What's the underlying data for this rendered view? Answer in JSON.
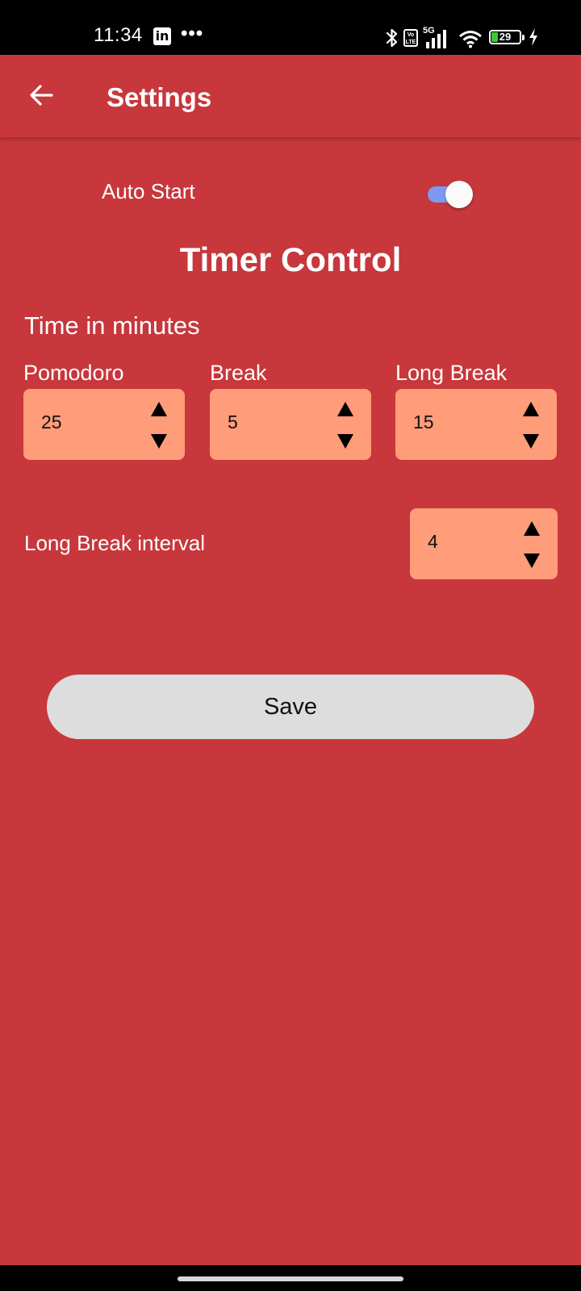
{
  "status_bar": {
    "time": "11:34",
    "linkedin_icon": "in",
    "more": "•••",
    "volte": "Vo LTE",
    "network": "5G",
    "battery": "29"
  },
  "app_bar": {
    "title": "Settings",
    "back_icon": "arrow-left-icon"
  },
  "settings": {
    "auto_start_label": "Auto Start",
    "auto_start_on": true,
    "section_title": "Timer Control",
    "subsection_label": "Time in minutes",
    "fields": [
      {
        "label": "Pomodoro",
        "value": "25"
      },
      {
        "label": "Break",
        "value": "5"
      },
      {
        "label": "Long Break",
        "value": "15"
      }
    ],
    "interval": {
      "label": "Long Break interval",
      "value": "4"
    },
    "save_label": "Save"
  },
  "colors": {
    "background": "#c7373b",
    "stepper": "#ff9c7a",
    "toggle_track": "#7b9af0",
    "button": "#dddddd"
  }
}
